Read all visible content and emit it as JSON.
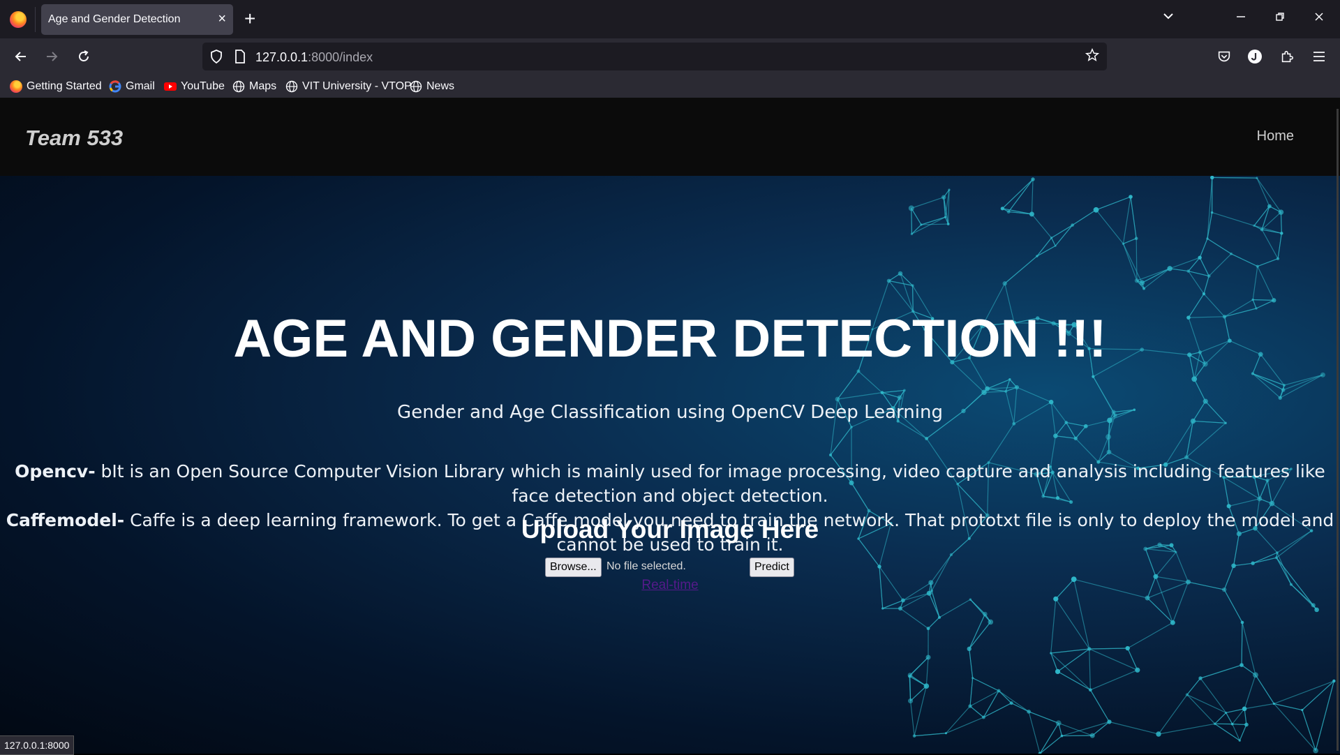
{
  "browser": {
    "tab_title": "Age and Gender Detection",
    "tab_close": "×",
    "new_tab": "+",
    "url_host": "127.0.0.1",
    "url_rest": ":8000/index",
    "bookmarks": [
      {
        "label": "Getting Started",
        "icon": "firefox-icon"
      },
      {
        "label": "Gmail",
        "icon": "google-icon"
      },
      {
        "label": "YouTube",
        "icon": "youtube-icon"
      },
      {
        "label": "Maps",
        "icon": "globe-icon"
      },
      {
        "label": "VIT University - VTOP",
        "icon": "globe-icon"
      },
      {
        "label": "News",
        "icon": "globe-icon"
      }
    ],
    "status_url": "127.0.0.1:8000"
  },
  "site": {
    "brand": "Team 533",
    "nav_home": "Home",
    "headline": "AGE AND GENDER DETECTION !!!",
    "subtitle": "Gender and Age Classification using OpenCV Deep Learning",
    "opencv_label": "Opencv-",
    "opencv_text": " bIt is an Open Source Computer Vision Library which is mainly used for image processing, video capture and analysis including features like face detection and object detection.",
    "caffe_label": "Caffemodel-",
    "caffe_text": " Caffe is a deep learning framework. To get a Caffe model you need to train the network. That prototxt file is only to deploy the model and cannot be used to train it.",
    "upload_title": "Upload Your Image Here",
    "browse_label": "Browse...",
    "file_status": "No file selected.",
    "predict_label": "Predict",
    "realtime_link": "Real-time"
  },
  "colors": {
    "chrome_dark": "#1c1b22",
    "chrome": "#2b2a33",
    "link_visited": "#551a8b",
    "accent_network": "#2fb7c9"
  }
}
